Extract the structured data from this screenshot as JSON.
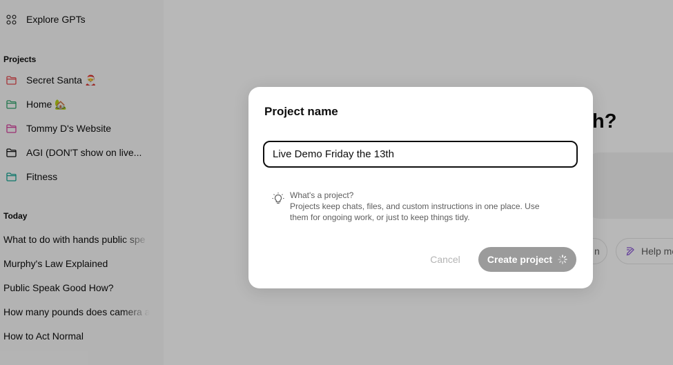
{
  "sidebar": {
    "explore": {
      "label": "Explore GPTs",
      "icon": "grid-icon"
    },
    "projects_heading": "Projects",
    "projects": [
      {
        "label": "Secret Santa 🎅",
        "color": "#e5484d"
      },
      {
        "label": "Home 🏡",
        "color": "#30a46c"
      },
      {
        "label": "Tommy D's Website",
        "color": "#d6409f"
      },
      {
        "label": "AGI (DON'T show on live...",
        "color": "#0d0d0d"
      },
      {
        "label": "Fitness",
        "color": "#12a594"
      }
    ],
    "today_heading": "Today",
    "chats": [
      "What to do with hands public spe",
      "Murphy's Law Explained",
      "Public Speak Good How?",
      "How many pounds does camera a",
      "How to Act Normal"
    ]
  },
  "main": {
    "heading_fragment": "h?",
    "pill_left": "n",
    "pill_right": "Help me"
  },
  "modal": {
    "title": "Project name",
    "input_value": "Live Demo Friday the 13th",
    "hint_title": "What's a project?",
    "hint_line1": "Projects keep chats, files, and custom instructions in one place. Use",
    "hint_line2": "them for ongoing work, or just to keep things tidy.",
    "cancel_label": "Cancel",
    "create_label": "Create project"
  }
}
